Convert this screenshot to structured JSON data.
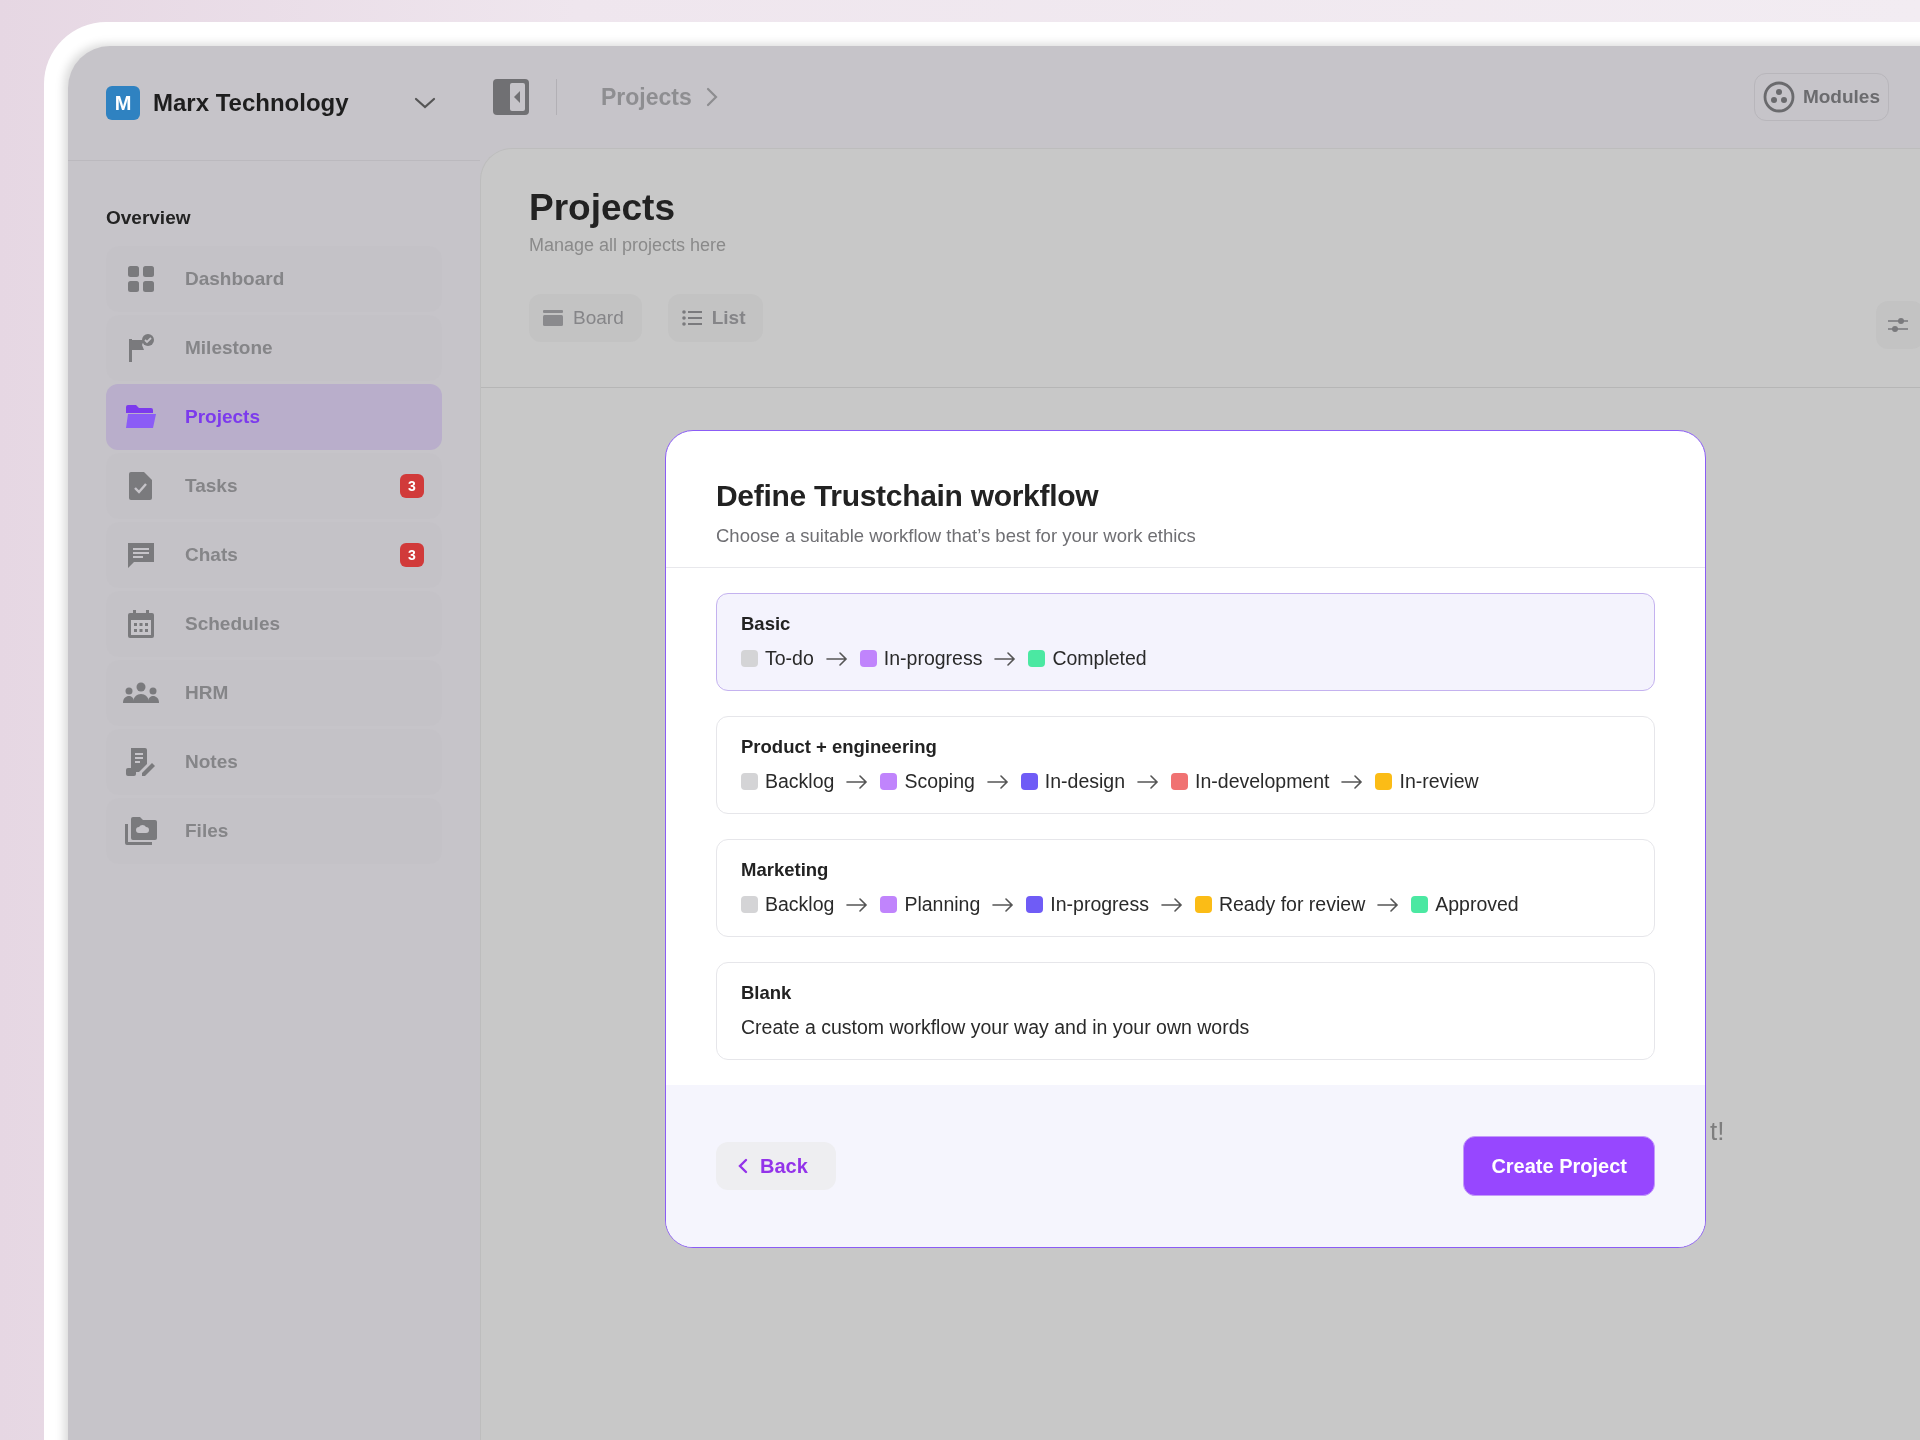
{
  "workspace": {
    "initial": "M",
    "name": "Marx Technology"
  },
  "breadcrumb": "Projects",
  "modules_button": "Modules",
  "sidebar": {
    "section": "Overview",
    "items": [
      {
        "label": "Dashboard",
        "selected": false
      },
      {
        "label": "Milestone",
        "selected": false
      },
      {
        "label": "Projects",
        "selected": true
      },
      {
        "label": "Tasks",
        "selected": false,
        "badge": "3"
      },
      {
        "label": "Chats",
        "selected": false,
        "badge": "3"
      },
      {
        "label": "Schedules",
        "selected": false
      },
      {
        "label": "HRM",
        "selected": false
      },
      {
        "label": "Notes",
        "selected": false
      },
      {
        "label": "Files",
        "selected": false
      }
    ]
  },
  "page": {
    "title": "Projects",
    "subtitle": "Manage all projects here",
    "views": [
      {
        "label": "Board",
        "kind": "board"
      },
      {
        "label": "List",
        "kind": "list"
      }
    ],
    "hidden_text": "t!"
  },
  "modal": {
    "title": "Define Trustchain workflow",
    "subtitle": "Choose a suitable workflow that’s best for your work ethics",
    "workflows": [
      {
        "name": "Basic",
        "selected": true,
        "kind": "steps",
        "steps": [
          {
            "label": "To-do",
            "color": "#d4d4d6"
          },
          {
            "label": "In-progress",
            "color": "#c084fc"
          },
          {
            "label": "Completed",
            "color": "#4be8a2"
          }
        ]
      },
      {
        "name": "Product + engineering",
        "selected": false,
        "kind": "steps",
        "steps": [
          {
            "label": "Backlog",
            "color": "#d4d4d6"
          },
          {
            "label": "Scoping",
            "color": "#c084fc"
          },
          {
            "label": "In-design",
            "color": "#6f5cf6"
          },
          {
            "label": "In-development",
            "color": "#f07272"
          },
          {
            "label": "In-review",
            "color": "#fbbc16"
          }
        ]
      },
      {
        "name": "Marketing",
        "selected": false,
        "kind": "steps",
        "steps": [
          {
            "label": "Backlog",
            "color": "#d4d4d6"
          },
          {
            "label": "Planning",
            "color": "#c084fc"
          },
          {
            "label": "In-progress",
            "color": "#6f5cf6"
          },
          {
            "label": "Ready for review",
            "color": "#fbbc16"
          },
          {
            "label": "Approved",
            "color": "#4be8a2"
          }
        ]
      },
      {
        "name": "Blank",
        "selected": false,
        "kind": "text",
        "description": "Create a custom workflow your way and in your own words"
      }
    ],
    "back_button": "Back",
    "create_button": "Create Project"
  }
}
